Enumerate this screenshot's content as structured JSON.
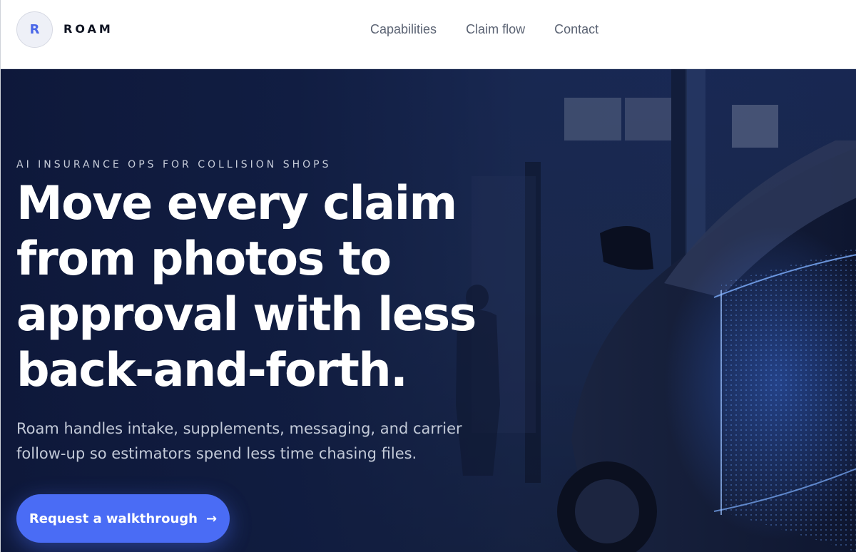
{
  "header": {
    "logo_letter": "R",
    "brand": "ROAM",
    "nav": [
      {
        "label": "Capabilities"
      },
      {
        "label": "Claim flow"
      },
      {
        "label": "Contact"
      }
    ]
  },
  "hero": {
    "eyebrow": "AI INSURANCE OPS FOR COLLISION SHOPS",
    "headline": "Move every claim from photos to approval with less back-and-forth.",
    "subcopy": "Roam handles intake, supplements, messaging, and carrier follow-up so estimators spend less time chasing files.",
    "cta_label": "Request a walkthrough",
    "cta_icon": "arrow-right-icon",
    "background_image": "car-in-garage-with-blue-wireframe-overlay"
  },
  "colors": {
    "accent": "#4a6cf5",
    "hero_bg": "#18285a",
    "nav_text": "#5b6373",
    "logo_letter": "#4a67e8"
  }
}
